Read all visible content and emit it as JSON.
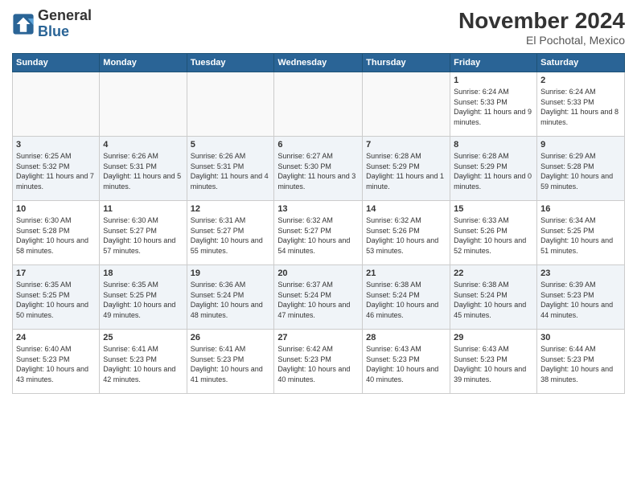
{
  "header": {
    "logo_line1": "General",
    "logo_line2": "Blue",
    "month": "November 2024",
    "location": "El Pochotal, Mexico"
  },
  "weekdays": [
    "Sunday",
    "Monday",
    "Tuesday",
    "Wednesday",
    "Thursday",
    "Friday",
    "Saturday"
  ],
  "weeks": [
    [
      {
        "day": "",
        "info": ""
      },
      {
        "day": "",
        "info": ""
      },
      {
        "day": "",
        "info": ""
      },
      {
        "day": "",
        "info": ""
      },
      {
        "day": "",
        "info": ""
      },
      {
        "day": "1",
        "info": "Sunrise: 6:24 AM\nSunset: 5:33 PM\nDaylight: 11 hours and 9 minutes."
      },
      {
        "day": "2",
        "info": "Sunrise: 6:24 AM\nSunset: 5:33 PM\nDaylight: 11 hours and 8 minutes."
      }
    ],
    [
      {
        "day": "3",
        "info": "Sunrise: 6:25 AM\nSunset: 5:32 PM\nDaylight: 11 hours and 7 minutes."
      },
      {
        "day": "4",
        "info": "Sunrise: 6:26 AM\nSunset: 5:31 PM\nDaylight: 11 hours and 5 minutes."
      },
      {
        "day": "5",
        "info": "Sunrise: 6:26 AM\nSunset: 5:31 PM\nDaylight: 11 hours and 4 minutes."
      },
      {
        "day": "6",
        "info": "Sunrise: 6:27 AM\nSunset: 5:30 PM\nDaylight: 11 hours and 3 minutes."
      },
      {
        "day": "7",
        "info": "Sunrise: 6:28 AM\nSunset: 5:29 PM\nDaylight: 11 hours and 1 minute."
      },
      {
        "day": "8",
        "info": "Sunrise: 6:28 AM\nSunset: 5:29 PM\nDaylight: 11 hours and 0 minutes."
      },
      {
        "day": "9",
        "info": "Sunrise: 6:29 AM\nSunset: 5:28 PM\nDaylight: 10 hours and 59 minutes."
      }
    ],
    [
      {
        "day": "10",
        "info": "Sunrise: 6:30 AM\nSunset: 5:28 PM\nDaylight: 10 hours and 58 minutes."
      },
      {
        "day": "11",
        "info": "Sunrise: 6:30 AM\nSunset: 5:27 PM\nDaylight: 10 hours and 57 minutes."
      },
      {
        "day": "12",
        "info": "Sunrise: 6:31 AM\nSunset: 5:27 PM\nDaylight: 10 hours and 55 minutes."
      },
      {
        "day": "13",
        "info": "Sunrise: 6:32 AM\nSunset: 5:27 PM\nDaylight: 10 hours and 54 minutes."
      },
      {
        "day": "14",
        "info": "Sunrise: 6:32 AM\nSunset: 5:26 PM\nDaylight: 10 hours and 53 minutes."
      },
      {
        "day": "15",
        "info": "Sunrise: 6:33 AM\nSunset: 5:26 PM\nDaylight: 10 hours and 52 minutes."
      },
      {
        "day": "16",
        "info": "Sunrise: 6:34 AM\nSunset: 5:25 PM\nDaylight: 10 hours and 51 minutes."
      }
    ],
    [
      {
        "day": "17",
        "info": "Sunrise: 6:35 AM\nSunset: 5:25 PM\nDaylight: 10 hours and 50 minutes."
      },
      {
        "day": "18",
        "info": "Sunrise: 6:35 AM\nSunset: 5:25 PM\nDaylight: 10 hours and 49 minutes."
      },
      {
        "day": "19",
        "info": "Sunrise: 6:36 AM\nSunset: 5:24 PM\nDaylight: 10 hours and 48 minutes."
      },
      {
        "day": "20",
        "info": "Sunrise: 6:37 AM\nSunset: 5:24 PM\nDaylight: 10 hours and 47 minutes."
      },
      {
        "day": "21",
        "info": "Sunrise: 6:38 AM\nSunset: 5:24 PM\nDaylight: 10 hours and 46 minutes."
      },
      {
        "day": "22",
        "info": "Sunrise: 6:38 AM\nSunset: 5:24 PM\nDaylight: 10 hours and 45 minutes."
      },
      {
        "day": "23",
        "info": "Sunrise: 6:39 AM\nSunset: 5:23 PM\nDaylight: 10 hours and 44 minutes."
      }
    ],
    [
      {
        "day": "24",
        "info": "Sunrise: 6:40 AM\nSunset: 5:23 PM\nDaylight: 10 hours and 43 minutes."
      },
      {
        "day": "25",
        "info": "Sunrise: 6:41 AM\nSunset: 5:23 PM\nDaylight: 10 hours and 42 minutes."
      },
      {
        "day": "26",
        "info": "Sunrise: 6:41 AM\nSunset: 5:23 PM\nDaylight: 10 hours and 41 minutes."
      },
      {
        "day": "27",
        "info": "Sunrise: 6:42 AM\nSunset: 5:23 PM\nDaylight: 10 hours and 40 minutes."
      },
      {
        "day": "28",
        "info": "Sunrise: 6:43 AM\nSunset: 5:23 PM\nDaylight: 10 hours and 40 minutes."
      },
      {
        "day": "29",
        "info": "Sunrise: 6:43 AM\nSunset: 5:23 PM\nDaylight: 10 hours and 39 minutes."
      },
      {
        "day": "30",
        "info": "Sunrise: 6:44 AM\nSunset: 5:23 PM\nDaylight: 10 hours and 38 minutes."
      }
    ]
  ]
}
